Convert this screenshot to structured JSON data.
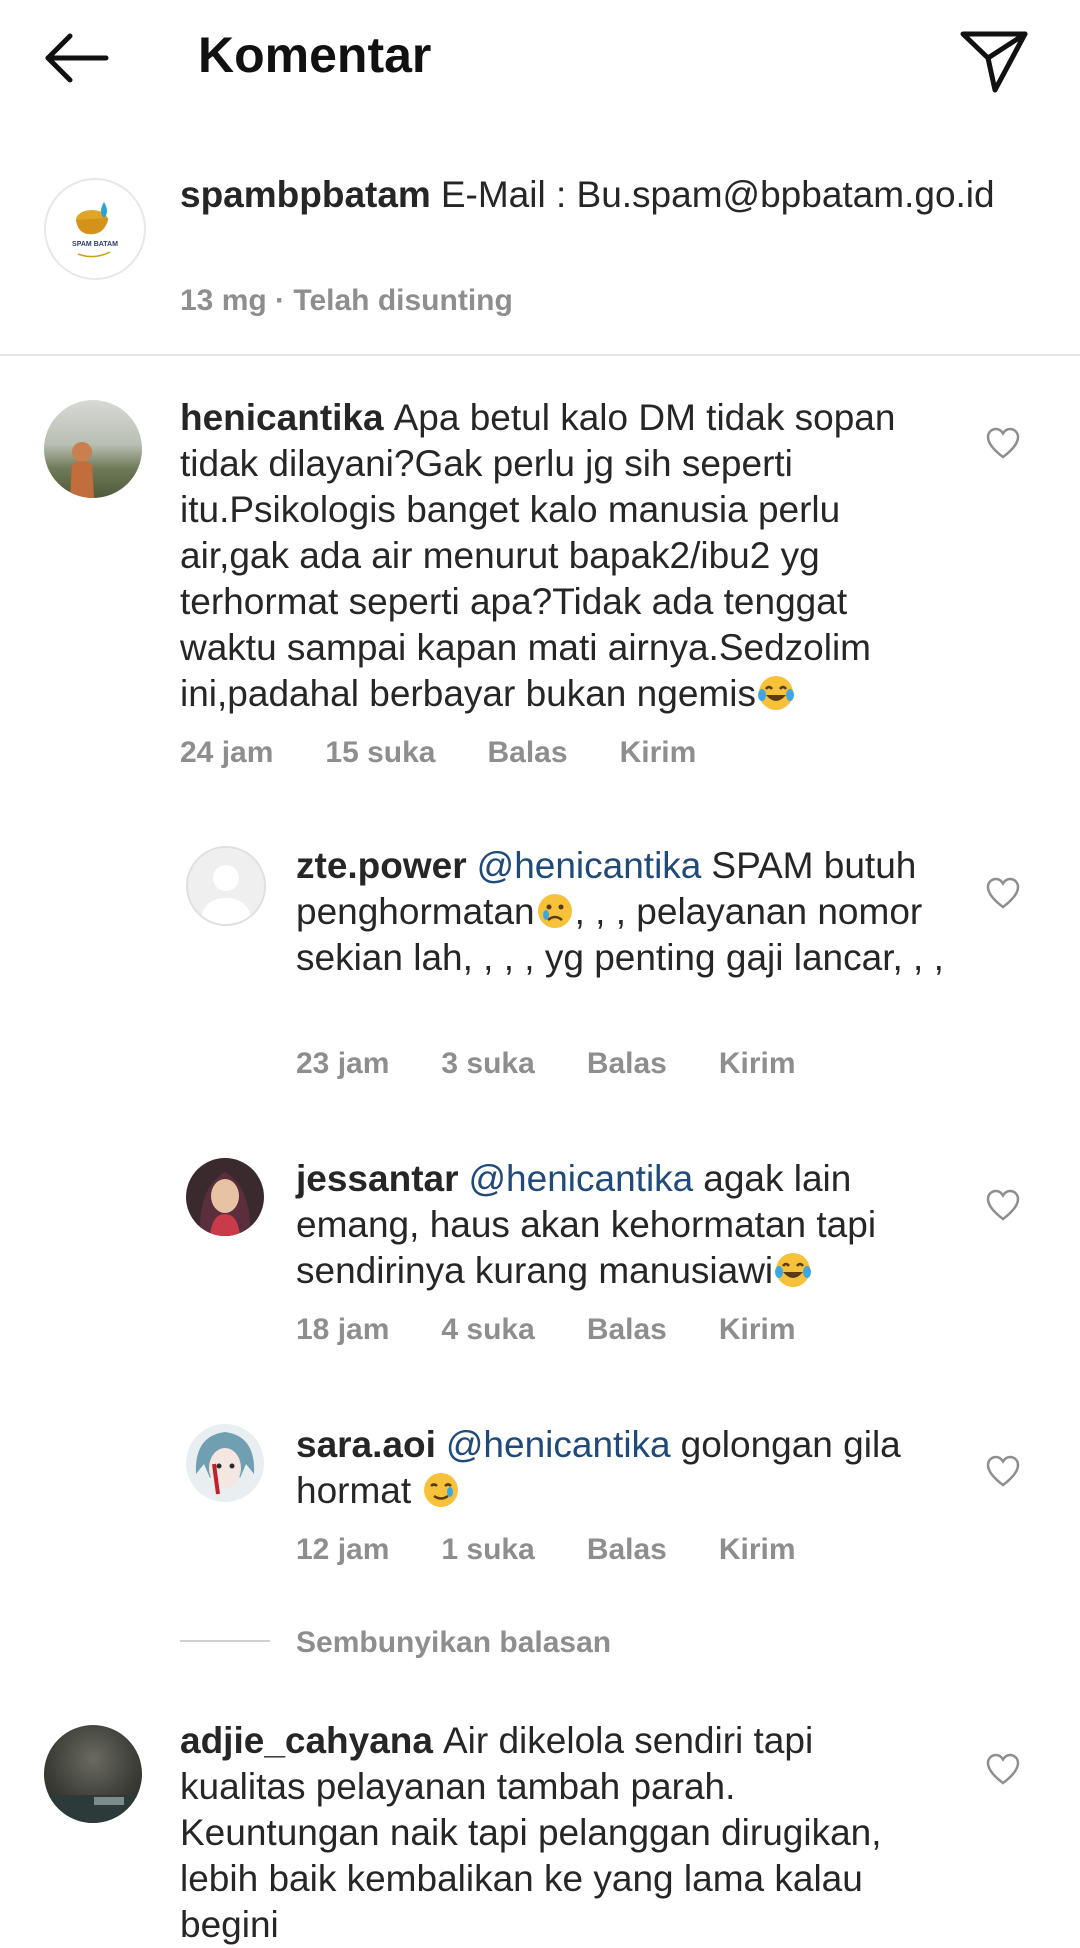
{
  "header": {
    "title": "Komentar"
  },
  "caption": {
    "username": "spambpbatam",
    "text": "E-Mail : Bu.spam@bpbatam.go.id",
    "meta": "13 mg · Telah disunting",
    "avatar_logo": "SPAM BATAM"
  },
  "comments": [
    {
      "username": "henicantika",
      "text": "Apa betul kalo DM tidak sopan tidak dilayani?Gak perlu jg sih seperti itu.Psikologis banget kalo manusia perlu air,gak ada air menurut bapak2/ibu2 yg terhormat seperti apa?Tidak ada tenggat waktu sampai kapan mati airnya.Sedzolim ini,padahal berbayar bukan ngemis",
      "emoji": "laughing-tears",
      "time": "24 jam",
      "likes": "15 suka",
      "reply": "Balas",
      "send": "Kirim"
    },
    {
      "username": "adjie_cahyana",
      "text": "Air dikelola sendiri tapi kualitas pelayanan tambah parah. Keuntungan naik tapi pelanggan dirugikan, lebih baik kembalikan ke yang lama kalau begini"
    }
  ],
  "replies": [
    {
      "username": "zte.power",
      "mention": "@henicantika",
      "text_before": "SPAM butuh penghormatan",
      "emoji": "crying-face",
      "text_after": ", , , pelayanan nomor sekian lah, , , , yg penting gaji lancar, , ,",
      "time": "23 jam",
      "likes": "3 suka",
      "reply": "Balas",
      "send": "Kirim"
    },
    {
      "username": "jessantar",
      "mention": "@henicantika",
      "text": "agak lain emang, haus akan kehormatan tapi sendirinya kurang manusiawi",
      "emoji": "laughing-tears",
      "time": "18 jam",
      "likes": "4 suka",
      "reply": "Balas",
      "send": "Kirim"
    },
    {
      "username": "sara.aoi",
      "mention": "@henicantika",
      "text": "golongan gila hormat",
      "emoji": "smiling-tear",
      "time": "12 jam",
      "likes": "1 suka",
      "reply": "Balas",
      "send": "Kirim"
    }
  ],
  "hide_replies": "Sembunyikan balasan"
}
